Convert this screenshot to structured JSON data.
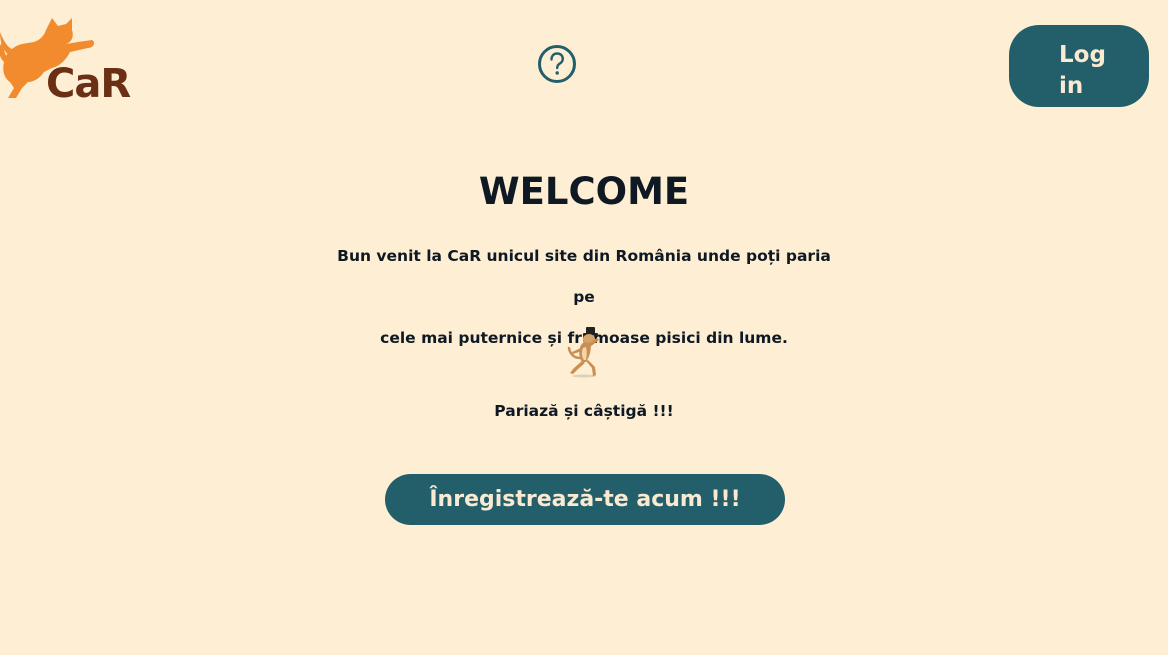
{
  "header": {
    "logo_text": "CaR",
    "login_label_line1": "Log",
    "login_label_line2": "in",
    "help_icon": "question-circle-icon"
  },
  "main": {
    "title": "WELCOME",
    "intro_line1": "Bun venit la CaR unicul site din România unde poți paria pe",
    "intro_line2": "cele mai puternice și frumoase pisici din lume.",
    "tagline": "Pariază și câștigă !!!",
    "register_label": "Înregistrează-te acum !!!"
  },
  "colors": {
    "background": "#fdeed4",
    "button": "#235f6b",
    "button_text": "#fbead2",
    "logo_cat": "#f28a2e",
    "logo_text": "#6a2f14",
    "text": "#0f1923"
  }
}
